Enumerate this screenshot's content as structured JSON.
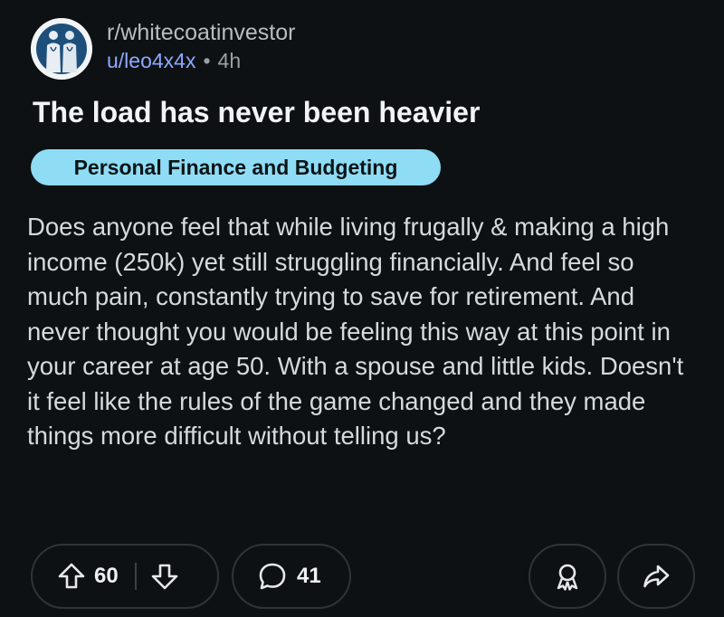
{
  "post": {
    "subreddit": "r/whitecoatinvestor",
    "author": "u/leo4x4x",
    "separator": "•",
    "age": "4h",
    "title": "The load has never been heavier",
    "flair": "Personal Finance and Budgeting",
    "body": "Does anyone feel that while living frugally & making a high income (250k) yet still struggling financially. And feel so much pain, constantly trying to save for retirement. And never thought you would be feeling this way at this point in your career at age 50. With a spouse and little kids. Doesn't it feel like the rules of the game changed and they made things more difficult without telling us?"
  },
  "actions": {
    "upvote_count": "60",
    "comment_count": "41",
    "icons": {
      "upvote": "arrow-up-icon",
      "downvote": "arrow-down-icon",
      "comment": "comment-bubble-icon",
      "award": "award-icon",
      "share": "share-icon"
    }
  },
  "colors": {
    "background": "#0d1114",
    "flair_background": "#8fdcf5",
    "username": "#8fa8ff"
  }
}
